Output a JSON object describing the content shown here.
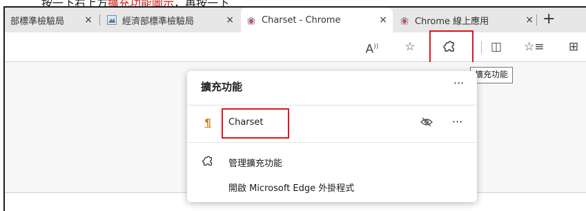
{
  "caption": {
    "prefix": "按一下右上方",
    "highlight": "擴充功能圖示",
    "suffix": "，再按一下"
  },
  "tabs": [
    {
      "title": "部標準檢驗局",
      "close": "×"
    },
    {
      "title": "經濟部標準檢驗局",
      "close": "×"
    },
    {
      "title": "Charset - Chrome",
      "close": "×"
    },
    {
      "title": "Chrome 線上應用",
      "close": "×"
    }
  ],
  "newtab": "+",
  "toolbar": {
    "read_aloud_icon": "A",
    "favorite_icon": "☆",
    "extensions_icon": "puzzle",
    "split_icon": "◫",
    "favorites_bar_icon": "☆≡",
    "collections_icon": "⊞"
  },
  "tooltip": "擴充功能",
  "popup": {
    "title": "擴充功能",
    "more": "···",
    "extension": {
      "icon": "¶",
      "name": "Charset",
      "more": "···"
    },
    "manage": "管理擴充功能",
    "addons": "開啟 Microsoft Edge 外掛程式"
  }
}
